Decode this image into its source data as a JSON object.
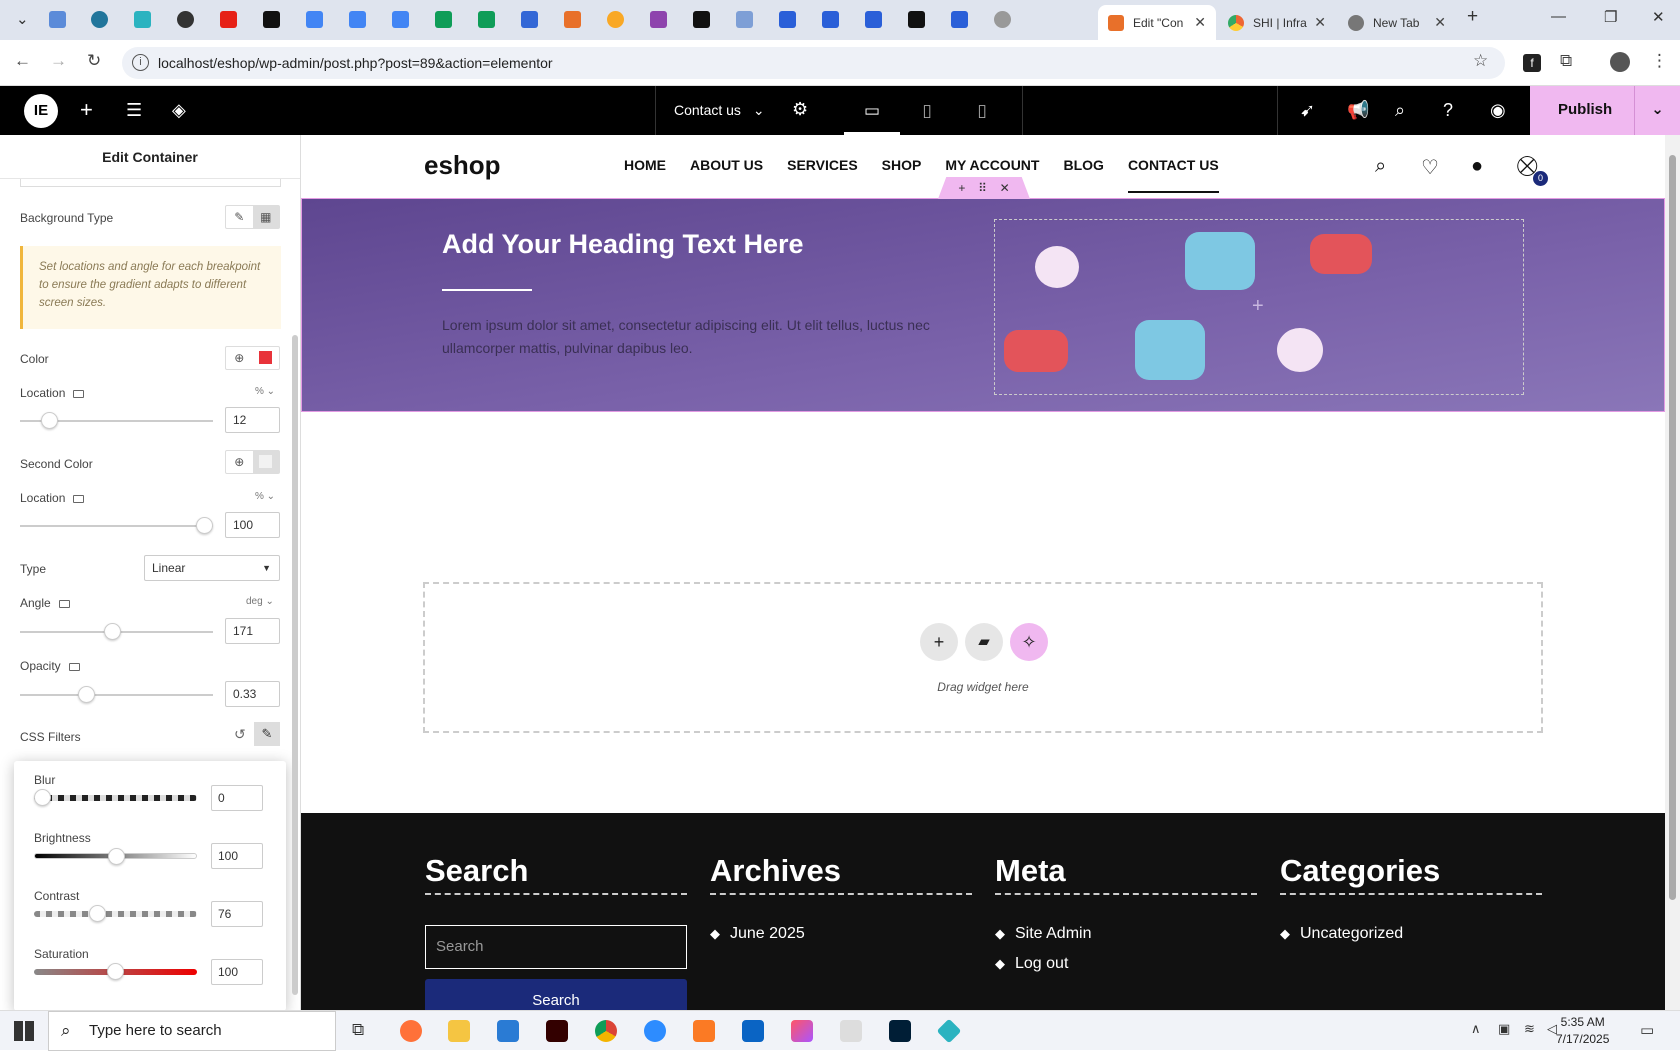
{
  "browser": {
    "tabs": [
      {
        "title": "Edit \"Con",
        "active": true
      },
      {
        "title": "SHI | Infra",
        "active": false
      },
      {
        "title": "New Tab",
        "active": false
      }
    ],
    "new_tab_label": "+",
    "url": "localhost/eshop/wp-admin/post.php?post=89&action=elementor"
  },
  "editor": {
    "page_name": "Contact us",
    "publish_label": "Publish"
  },
  "panel": {
    "title": "Edit Container",
    "background_type_label": "Background Type",
    "gradient_note": "Set locations and angle for each breakpoint to ensure the gradient adapts to different screen sizes.",
    "color_label": "Color",
    "color_value": "#e8333a",
    "location_label": "Location",
    "location_unit": "%",
    "location_value": "12",
    "second_color_label": "Second Color",
    "second_color_value": "#f2f2f2",
    "location2_value": "100",
    "type_label": "Type",
    "type_value": "Linear",
    "angle_label": "Angle",
    "angle_unit": "deg",
    "angle_value": "171",
    "opacity_label": "Opacity",
    "opacity_value": "0.33",
    "css_filters_label": "CSS Filters",
    "filters": [
      {
        "label": "Blur",
        "value": "0",
        "fraction": 0.0
      },
      {
        "label": "Brightness",
        "value": "100",
        "fraction": 0.5
      },
      {
        "label": "Contrast",
        "value": "76",
        "fraction": 0.38
      },
      {
        "label": "Saturation",
        "value": "100",
        "fraction": 0.5
      }
    ]
  },
  "site": {
    "logo": "eshop",
    "nav": [
      "HOME",
      "ABOUT US",
      "SERVICES",
      "SHOP",
      "MY ACCOUNT",
      "BLOG",
      "CONTACT US"
    ],
    "cart_count": "0",
    "hero_title": "Add Your Heading Text Here",
    "hero_text": "Lorem ipsum dolor sit amet, consectetur adipiscing elit. Ut elit tellus, luctus nec ullamcorper mattis, pulvinar dapibus leo.",
    "drop_hint": "Drag widget here",
    "footer": {
      "search_title": "Search",
      "search_placeholder": "Search",
      "search_button": "Search",
      "archives_title": "Archives",
      "archives": [
        "June 2025"
      ],
      "meta_title": "Meta",
      "meta": [
        "Site Admin",
        "Log out"
      ],
      "categories_title": "Categories",
      "categories": [
        "Uncategorized"
      ]
    }
  },
  "taskbar": {
    "search_placeholder": "Type here to search",
    "time": "5:35 AM",
    "date": "7/17/2025"
  }
}
